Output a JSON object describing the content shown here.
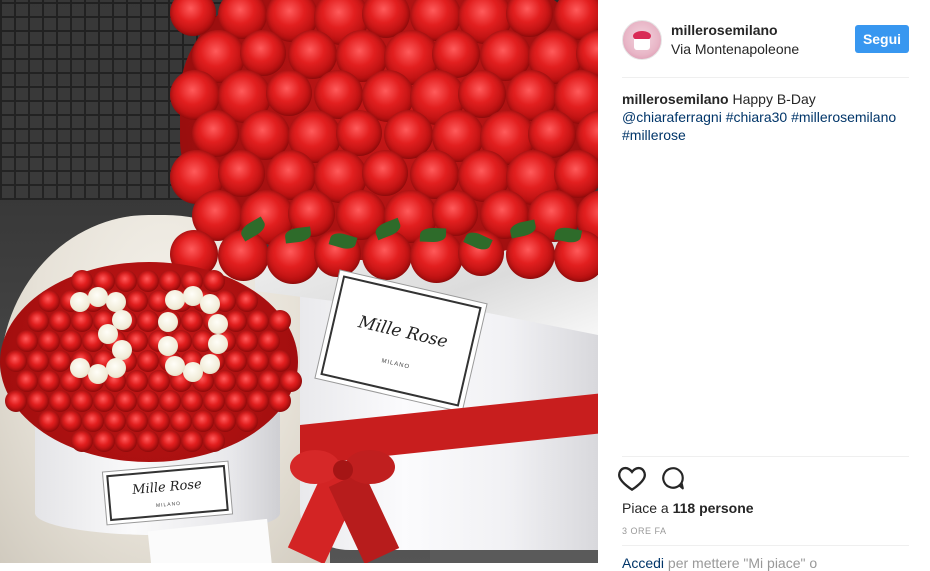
{
  "post": {
    "image_alt_labels": {
      "big_box_brand": "Mille Rose",
      "big_box_city": "MILANO",
      "small_box_brand": "Mille Rose",
      "small_box_city": "MILANO",
      "roses_number": "30"
    }
  },
  "header": {
    "username": "millerosemilano",
    "location": "Via Montenapoleone",
    "follow_label": "Segui"
  },
  "caption": {
    "author": "millerosemilano",
    "text": "Happy B-Day",
    "mention": "@chiaraferragni",
    "tags": [
      "#chiara30",
      "#millerosemilano",
      "#millerose"
    ]
  },
  "actions": {
    "like_icon": "heart-icon",
    "comment_icon": "comment-icon"
  },
  "likes": {
    "prefix": "Piace a",
    "count": "118",
    "suffix": "persone"
  },
  "timestamp": "3 ORE FA",
  "comment_box": {
    "login_link": "Accedi",
    "rest": "per mettere \"Mi piace\" o"
  },
  "colors": {
    "follow_button": "#3897f0",
    "link": "#003569",
    "rose_red": "#e21f1f"
  }
}
